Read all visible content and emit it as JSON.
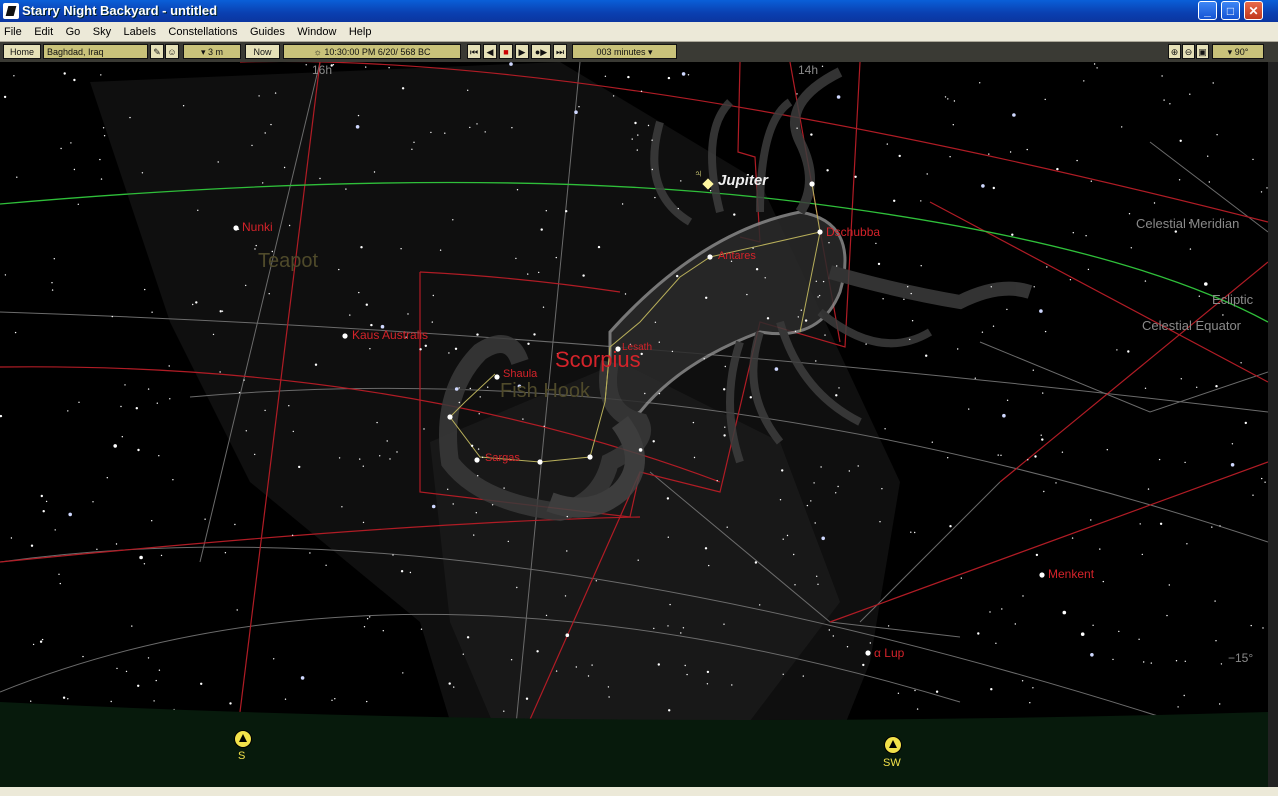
{
  "window": {
    "title": "Starry Night Backyard - untitled",
    "controls": [
      "_",
      "□",
      "✕"
    ]
  },
  "menu": [
    "File",
    "Edit",
    "Go",
    "Sky",
    "Labels",
    "Constellations",
    "Guides",
    "Window",
    "Help"
  ],
  "toolbar": {
    "home_label": "Home",
    "location": "Baghdad, Iraq",
    "elevation": "▾ 3 m",
    "now_label": "Now",
    "time": "10:30:00 PM",
    "date": "6/20/",
    "year": "568 BC",
    "time_step": "003 minutes ▾",
    "fov": "▾ 90°"
  },
  "sky": {
    "ra_labels": [
      "16h",
      "14h"
    ],
    "constellation_name": "Scorpius",
    "asterisms": [
      "Teapot",
      "Fish Hook"
    ],
    "planet": {
      "name": "Jupiter",
      "symbol": "♃"
    },
    "stars": [
      "Nunki",
      "Kaus Australis",
      "Shaula",
      "Sargas",
      "Lesath",
      "Antares",
      "Dschubba",
      "Menkent",
      "α Lup"
    ],
    "guides": [
      "Celestial Meridian",
      "Ecliptic",
      "Celestial Equator"
    ],
    "alt_label": "−15°",
    "compass": [
      "S",
      "SW"
    ]
  },
  "colors": {
    "ecliptic": "#2fbf3a",
    "boundaries": "#c0202a",
    "figures": "#b7ae5a",
    "labels_red": "#d4232a",
    "horizon": "#071a0c"
  }
}
